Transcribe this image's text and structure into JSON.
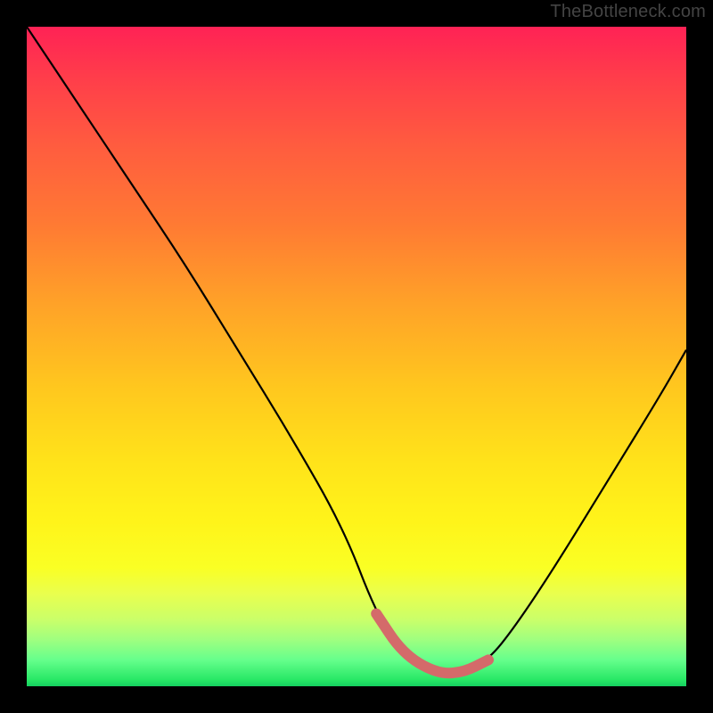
{
  "watermark": "TheBottleneck.com",
  "chart_data": {
    "type": "line",
    "title": "",
    "xlabel": "",
    "ylabel": "",
    "xlim": [
      0,
      100
    ],
    "ylim": [
      0,
      100
    ],
    "series": [
      {
        "name": "bottleneck-curve",
        "color": "#000000",
        "x": [
          0,
          8,
          16,
          24,
          32,
          40,
          48,
          53,
          57,
          62,
          66,
          70,
          74,
          80,
          88,
          96,
          100
        ],
        "values": [
          100,
          88,
          76,
          64,
          51,
          38,
          24,
          11,
          5,
          2,
          2,
          4,
          9,
          18,
          31,
          44,
          51
        ]
      },
      {
        "name": "optimal-highlight",
        "color": "#d46a6a",
        "x": [
          53,
          57,
          62,
          66,
          70
        ],
        "values": [
          11,
          5,
          2,
          2,
          4
        ]
      }
    ],
    "gradient_stops": [
      {
        "pct": 0,
        "color": "#ff2255"
      },
      {
        "pct": 8,
        "color": "#ff3e4a"
      },
      {
        "pct": 18,
        "color": "#ff5c3f"
      },
      {
        "pct": 30,
        "color": "#ff7a33"
      },
      {
        "pct": 42,
        "color": "#ffa228"
      },
      {
        "pct": 55,
        "color": "#ffc81e"
      },
      {
        "pct": 66,
        "color": "#ffe31a"
      },
      {
        "pct": 75,
        "color": "#fff41a"
      },
      {
        "pct": 82,
        "color": "#faff24"
      },
      {
        "pct": 86,
        "color": "#e9ff4e"
      },
      {
        "pct": 90,
        "color": "#c9ff6a"
      },
      {
        "pct": 93,
        "color": "#9eff80"
      },
      {
        "pct": 96,
        "color": "#66ff8c"
      },
      {
        "pct": 99,
        "color": "#28e866"
      },
      {
        "pct": 100,
        "color": "#15d060"
      }
    ]
  }
}
